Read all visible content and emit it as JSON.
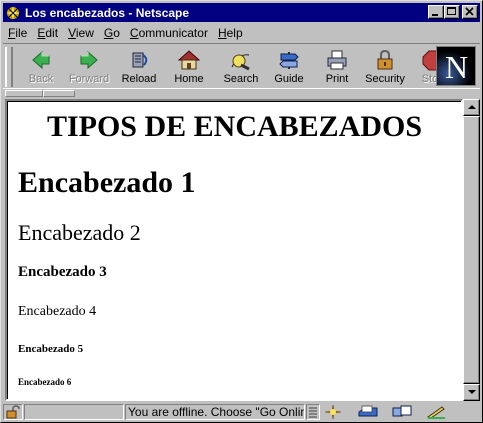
{
  "window": {
    "title": "Los encabezados - Netscape",
    "buttons": {
      "minimize": "_",
      "maximize": "□",
      "close": "×"
    }
  },
  "menu": [
    {
      "label": "File",
      "u": "F",
      "rest": "ile"
    },
    {
      "label": "Edit",
      "u": "E",
      "rest": "dit"
    },
    {
      "label": "View",
      "u": "V",
      "rest": "iew"
    },
    {
      "label": "Go",
      "u": "G",
      "rest": "o"
    },
    {
      "label": "Communicator",
      "u": "C",
      "rest": "ommunicator"
    },
    {
      "label": "Help",
      "u": "H",
      "rest": "elp"
    }
  ],
  "toolbar": {
    "back": "Back",
    "forward": "Forward",
    "reload": "Reload",
    "home": "Home",
    "search": "Search",
    "guide": "Guide",
    "print": "Print",
    "security": "Security",
    "stop": "Stop",
    "logo": "N"
  },
  "page": {
    "title": "TIPOS DE ENCABEZADOS",
    "h1": "Encabezado 1",
    "h2": "Encabezado 2",
    "h3": "Encabezado 3",
    "h4": "Encabezado 4",
    "h5": "Encabezado 5",
    "h6": "Encabezado 6"
  },
  "status": {
    "text": "You are offline. Choose \"Go Online..."
  },
  "colors": {
    "titlebar": "#000080",
    "chrome": "#c0c0c0"
  }
}
